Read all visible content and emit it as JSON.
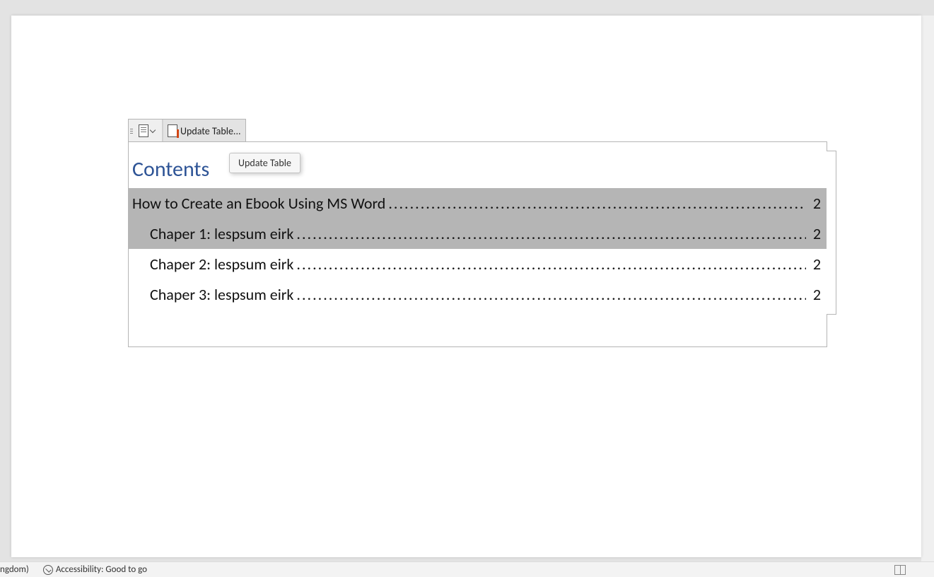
{
  "toolbar": {
    "update_label": "Update Table..."
  },
  "tooltip": {
    "text": "Update Table"
  },
  "toc": {
    "heading": "Contents",
    "entries": [
      {
        "title": "How to Create an Ebook Using MS Word",
        "page": "2",
        "level": 1,
        "selected": true
      },
      {
        "title": "Chaper 1: lespsum eirk",
        "page": "2",
        "level": 2,
        "selected": true
      },
      {
        "title": "Chaper 2: lespsum eirk",
        "page": "2",
        "level": 2,
        "selected": false
      },
      {
        "title": "Chaper 3: lespsum eirk",
        "page": "2",
        "level": 2,
        "selected": false
      }
    ]
  },
  "statusbar": {
    "language_partial": "ngdom)",
    "accessibility": "Accessibility: Good to go"
  }
}
